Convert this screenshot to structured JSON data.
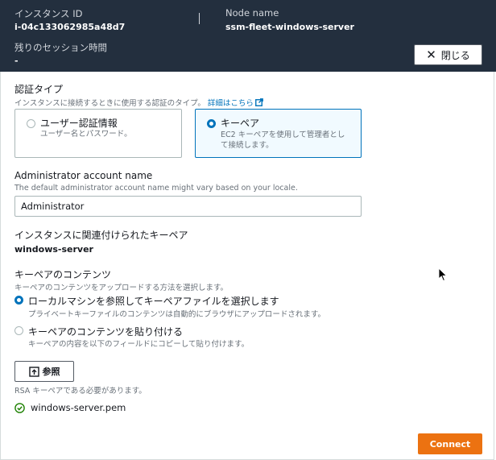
{
  "header": {
    "instance_id_label": "インスタンス ID",
    "instance_id_value": "i-04c133062985a48d7",
    "node_name_label": "Node name",
    "node_name_value": "ssm-fleet-windows-server",
    "session_time_label": "残りのセッション時間",
    "session_time_value": "-",
    "close_label": "閉じる",
    "bg_color": "#232f3e"
  },
  "auth": {
    "title": "認証タイプ",
    "description": "インスタンスに接続するときに使用する認証のタイプ。",
    "learn_more": "詳細はこちら",
    "options": [
      {
        "title": "ユーザー認証情報",
        "desc": "ユーザー名とパスワード。",
        "selected": false
      },
      {
        "title": "キーペア",
        "desc_line1": "EC2 キーペアを使用して管理者とし",
        "desc_line2": "て接続します。",
        "selected": true
      }
    ]
  },
  "admin": {
    "label": "Administrator account name",
    "description": "The default administrator account name might vary based on your locale.",
    "value": "Administrator"
  },
  "keypair": {
    "label": "インスタンスに関連付けられたキーペア",
    "value": "windows-server"
  },
  "content": {
    "title": "キーペアのコンテンツ",
    "description": "キーペアのコンテンツをアップロードする方法を選択します。",
    "options": [
      {
        "title": "ローカルマシンを参照してキーペアファイルを選択します",
        "desc": "プライベートキーファイルのコンテンツは自動的にブラウザにアップロードされます。",
        "selected": true
      },
      {
        "title": "キーペアのコンテンツを貼り付ける",
        "desc": "キーペアの内容を以下のフィールドにコピーして貼り付けます。",
        "selected": false
      }
    ],
    "browse_label": "参照",
    "browse_hint": "RSA キーペアである必要があります。",
    "file_name": "windows-server.pem"
  },
  "connect_label": "Connect",
  "colors": {
    "accent": "#0073bb",
    "primary_button": "#ec7211",
    "success": "#1d8102"
  }
}
